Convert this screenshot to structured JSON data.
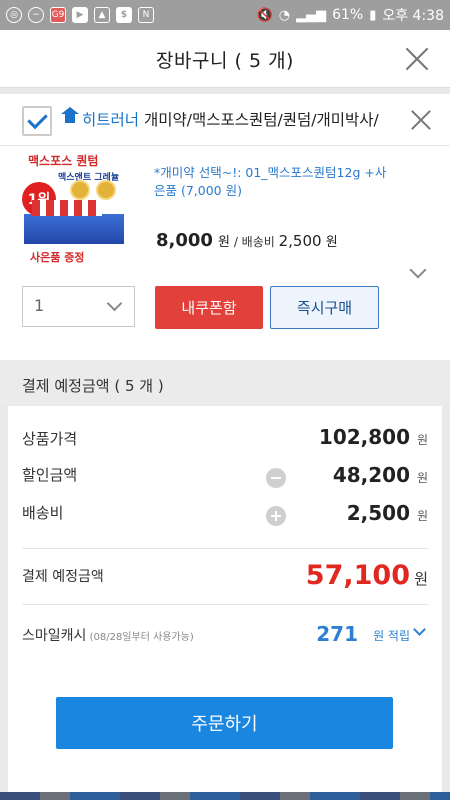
{
  "status_bar": {
    "battery_percent": "61%",
    "time": "오후 4:38",
    "left_icons": [
      "chrome-icon",
      "minus-circle-icon",
      "g9-app-icon",
      "youtube-icon",
      "image-icon",
      "dollar-app-icon",
      "nfc-icon"
    ],
    "g9_label": "G9"
  },
  "header": {
    "title": "장바구니 ( 5 개)"
  },
  "cart_item": {
    "seller_name": "히트러너",
    "seller_categories": " 개미약/맥스포스퀀텀/퀀덤/개미박사/",
    "product_image": {
      "title": "맥스포스 퀀텀",
      "subtitle": "맥스앤트 그레뉼",
      "rank": "1위",
      "bottom_text": "사은품 증정"
    },
    "option_text": "*개미약 선택~!: 01_맥스포스퀀텀12g +사은품 (7,000 원)",
    "price": "8,000",
    "price_unit": "원",
    "shipping_label": " / 배송비 ",
    "shipping": "2,500",
    "shipping_unit": " 원",
    "quantity": "1",
    "coupon_button": "내쿠폰함",
    "buy_now_button": "즉시구매"
  },
  "summary": {
    "header_title": "결제 예정금액 ( 5 개 )",
    "rows": [
      {
        "label": "상품가격",
        "value": "102,800",
        "unit": "원"
      },
      {
        "label": "할인금액",
        "value": "48,200",
        "unit": "원"
      },
      {
        "label": "배송비",
        "value": "2,500",
        "unit": "원"
      }
    ],
    "total_label": "결제 예정금액",
    "total_value": "57,100",
    "total_unit": "원",
    "smile_label": "스마일캐시",
    "smile_note": " (08/28일부터 사용가능)",
    "smile_value": "271",
    "smile_unit": "원 적립",
    "order_button": "주문하기"
  },
  "colors": {
    "accent_blue": "#1a86e0",
    "price_red": "#e0281f",
    "coupon_red": "#e1413a",
    "link_blue": "#1a73c9"
  }
}
